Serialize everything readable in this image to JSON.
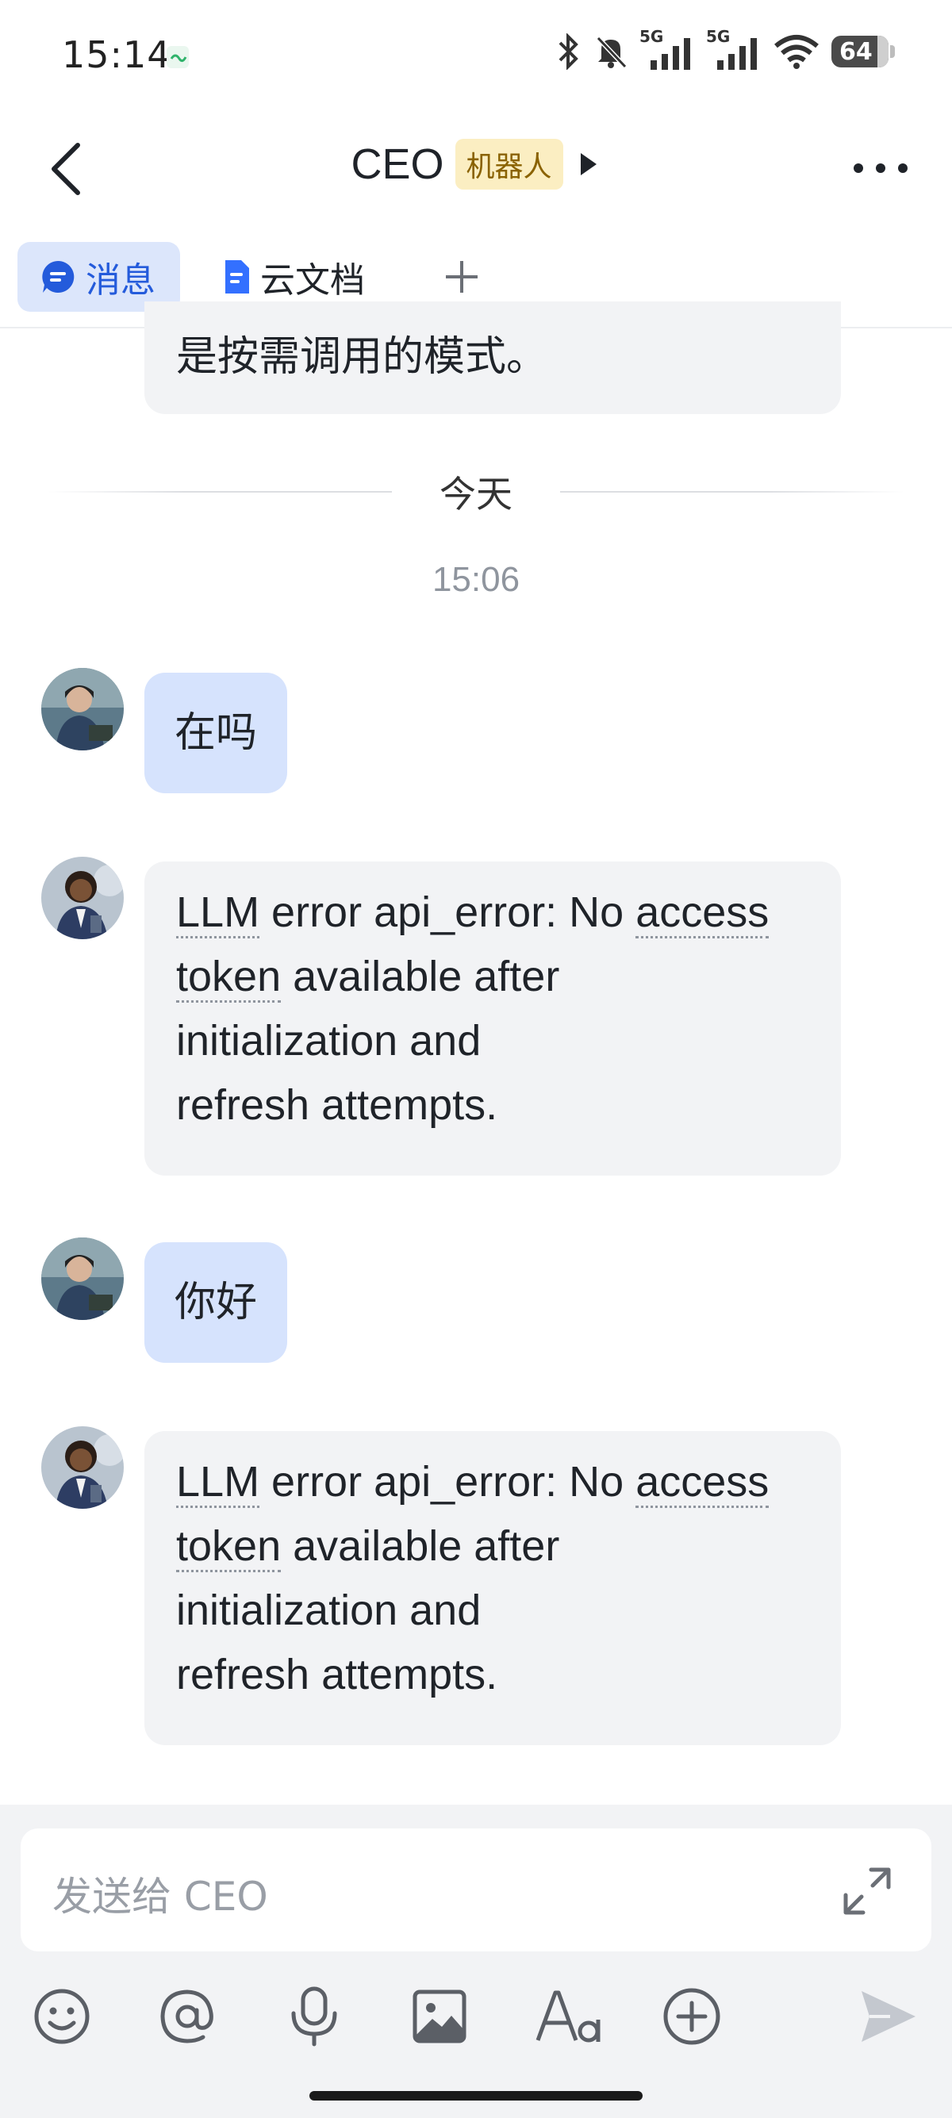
{
  "status_bar": {
    "time": "15:14",
    "battery": "64",
    "network_1": "5G",
    "network_2": "5G"
  },
  "header": {
    "title": "CEO",
    "badge": "机器人"
  },
  "tabs": [
    {
      "label": "消息",
      "active": true
    },
    {
      "label": "云文档",
      "active": false
    }
  ],
  "messages": {
    "partial_text": "是按需调用的模式。",
    "date_divider": "今天",
    "timestamp": "15:06",
    "items": [
      {
        "sender": "user",
        "text": "在吗"
      },
      {
        "sender": "ceo-bot",
        "prefix": "LLM",
        "mid1": " error api_error: No ",
        "link1": "access",
        "link1b": "token",
        "mid2": " available after",
        "rest": "initialization and refresh attempts."
      },
      {
        "sender": "user",
        "text": "你好"
      },
      {
        "sender": "ceo-bot",
        "prefix": "LLM",
        "mid1": " error api_error: No ",
        "link1": "access",
        "link1b": "token",
        "mid2": " available after",
        "rest": "initialization and refresh attempts."
      }
    ]
  },
  "composer": {
    "placeholder": "发送给 CEO",
    "tools": [
      "emoji-icon",
      "mention-icon",
      "microphone-icon",
      "image-icon",
      "text-format-icon",
      "plus-circle-icon",
      "send-icon"
    ]
  },
  "colors": {
    "accent": "#245bdb",
    "bubble_gray": "#f2f3f5",
    "bubble_blue": "#d6e3fd",
    "badge_bg": "#fbeec2"
  }
}
